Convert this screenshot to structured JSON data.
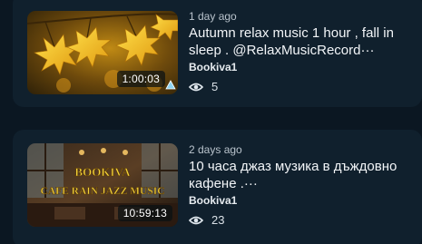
{
  "videos": [
    {
      "date": "1 day ago",
      "title": "Autumn relax music 1 hour , fall in sleep . @RelaxMusicRecord···",
      "author": "Bookiva1",
      "duration": "1:00:03",
      "views": "5",
      "thumbnail_icon": "autumn-leaves-thumbnail"
    },
    {
      "date": "2 days ago",
      "title": "10 часа джаз музика в дъждовно кафене .···",
      "author": "Bookiva1",
      "duration": "10:59:13",
      "views": "23",
      "thumbnail_icon": "cafe-interior-thumbnail",
      "thumbnail_text": {
        "line1": "BOOKIVA",
        "line2": "CAFE RAIN JAZZ MUSIC"
      }
    }
  ],
  "icons": {
    "views": "eye-icon",
    "badge": "triangle-badge-icon"
  },
  "colors": {
    "background": "#0b1722",
    "card": "#10202d",
    "text": "#f2f5f8",
    "thumbnail_text": "#f3d23a"
  }
}
